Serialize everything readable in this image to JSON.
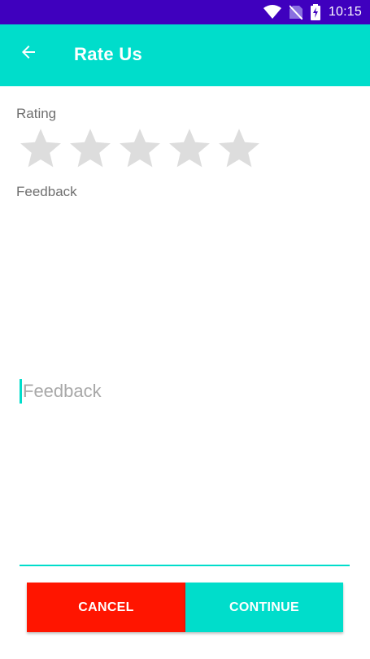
{
  "status_bar": {
    "time": "10:15",
    "icons": [
      "wifi-icon",
      "no-sim-icon",
      "battery-charging-icon"
    ]
  },
  "app_bar": {
    "title": "Rate Us",
    "back_icon": "arrow-back-icon"
  },
  "rating": {
    "label": "Rating",
    "max_stars": 5,
    "value": 0
  },
  "feedback": {
    "label": "Feedback",
    "placeholder": "Feedback",
    "value": ""
  },
  "buttons": {
    "cancel_label": "CANCEL",
    "continue_label": "CONTINUE"
  },
  "colors": {
    "status_bar": "#3F00BE",
    "accent": "#00DDCB",
    "cancel": "#FF1500",
    "star_empty": "#DDDDDD",
    "label": "#6F6F6F"
  }
}
